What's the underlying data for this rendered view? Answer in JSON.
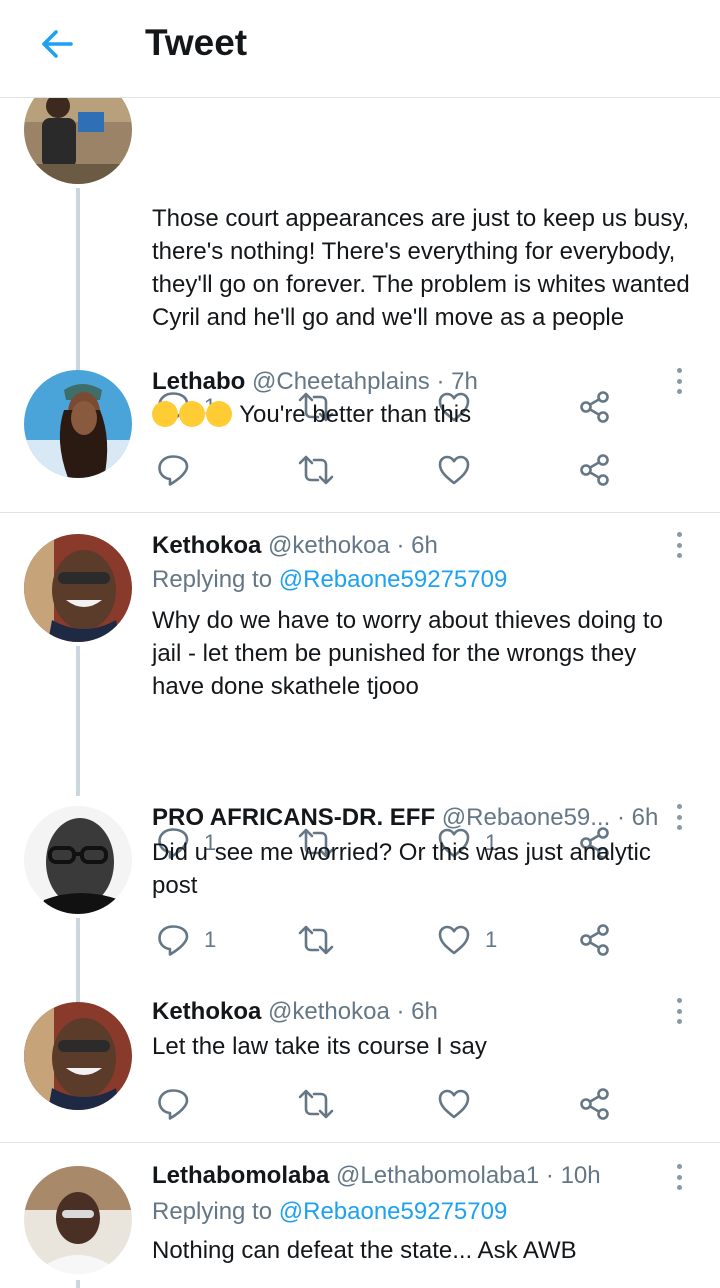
{
  "header": {
    "title": "Tweet"
  },
  "tweets": [
    {
      "text": "Those court appearances are just to keep us busy, there's nothing! There's everything for everybody, they'll go on forever. The problem is whites wanted Cyril and he'll go and we'll move as a people",
      "reply_count": "1",
      "like_count": ""
    },
    {
      "name": "Lethabo",
      "handle": "@Cheetahplains",
      "dot": "·",
      "time": "7h",
      "text": "You're better than this",
      "reply_count": "",
      "like_count": ""
    },
    {
      "name": "Kethokoa",
      "handle": "@kethokoa",
      "dot": "·",
      "time": "6h",
      "replying_label": "Replying to",
      "replying_to": "@Rebaone59275709",
      "text": "Why do we have to worry about thieves doing to jail - let them be punished for the wrongs they have done skathele tjooo",
      "reply_count": "1",
      "like_count": "1"
    },
    {
      "name": "PRO AFRICANS-DR. EFF",
      "handle": "@Rebaone59...",
      "dot": "·",
      "time": "6h",
      "text": "Did u see me worried? Or this was just analytic post",
      "reply_count": "1",
      "like_count": "1"
    },
    {
      "name": "Kethokoa",
      "handle": "@kethokoa",
      "dot": "·",
      "time": "6h",
      "text": "Let the law take its  course I say",
      "reply_count": "",
      "like_count": ""
    },
    {
      "name": "Lethabomolaba",
      "handle": "@Lethabomolaba1",
      "dot": "·",
      "time": "10h",
      "replying_label": "Replying to",
      "replying_to": "@Rebaone59275709",
      "text": "Nothing can defeat the state... Ask AWB"
    }
  ],
  "colors": {
    "accent": "#1da1f2",
    "secondary_text": "#657786",
    "thread_line": "#ccd6dd",
    "emoji": "#ffcc33"
  },
  "icons": [
    "back-arrow-icon",
    "reply-icon",
    "retweet-icon",
    "like-icon",
    "share-icon",
    "more-icon",
    "rolling-laughing-emoji"
  ]
}
